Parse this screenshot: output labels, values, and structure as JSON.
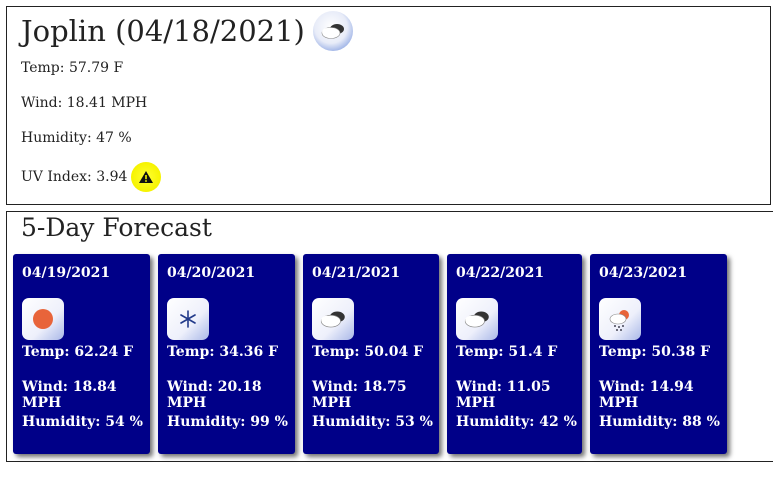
{
  "current": {
    "title": "Joplin (04/18/2021)",
    "icon": "cloudy-icon",
    "temp": "Temp: 57.79 F",
    "wind": "Wind: 18.41 MPH",
    "humidity": "Humidity: 47 %",
    "uv_label": "UV Index: 3.94",
    "uv_color": "#f6f300"
  },
  "forecast": {
    "title": "5-Day Forecast",
    "card_color": "#000088",
    "days": [
      {
        "date": "04/19/2021",
        "icon": "sun-icon",
        "temp": "Temp: 62.24 F",
        "wind": "Wind: 18.84 MPH",
        "humidity": "Humidity: 54 %"
      },
      {
        "date": "04/20/2021",
        "icon": "snow-icon",
        "temp": "Temp: 34.36 F",
        "wind": "Wind: 20.18 MPH",
        "humidity": "Humidity: 99 %"
      },
      {
        "date": "04/21/2021",
        "icon": "cloudy-icon",
        "temp": "Temp: 50.04 F",
        "wind": "Wind: 18.75 MPH",
        "humidity": "Humidity: 53 %"
      },
      {
        "date": "04/22/2021",
        "icon": "cloudy-icon",
        "temp": "Temp: 51.4 F",
        "wind": "Wind: 11.05 MPH",
        "humidity": "Humidity: 42 %"
      },
      {
        "date": "04/23/2021",
        "icon": "rain-sun-icon",
        "temp": "Temp: 50.38 F",
        "wind": "Wind: 14.94 MPH",
        "humidity": "Humidity: 88 %"
      }
    ]
  }
}
